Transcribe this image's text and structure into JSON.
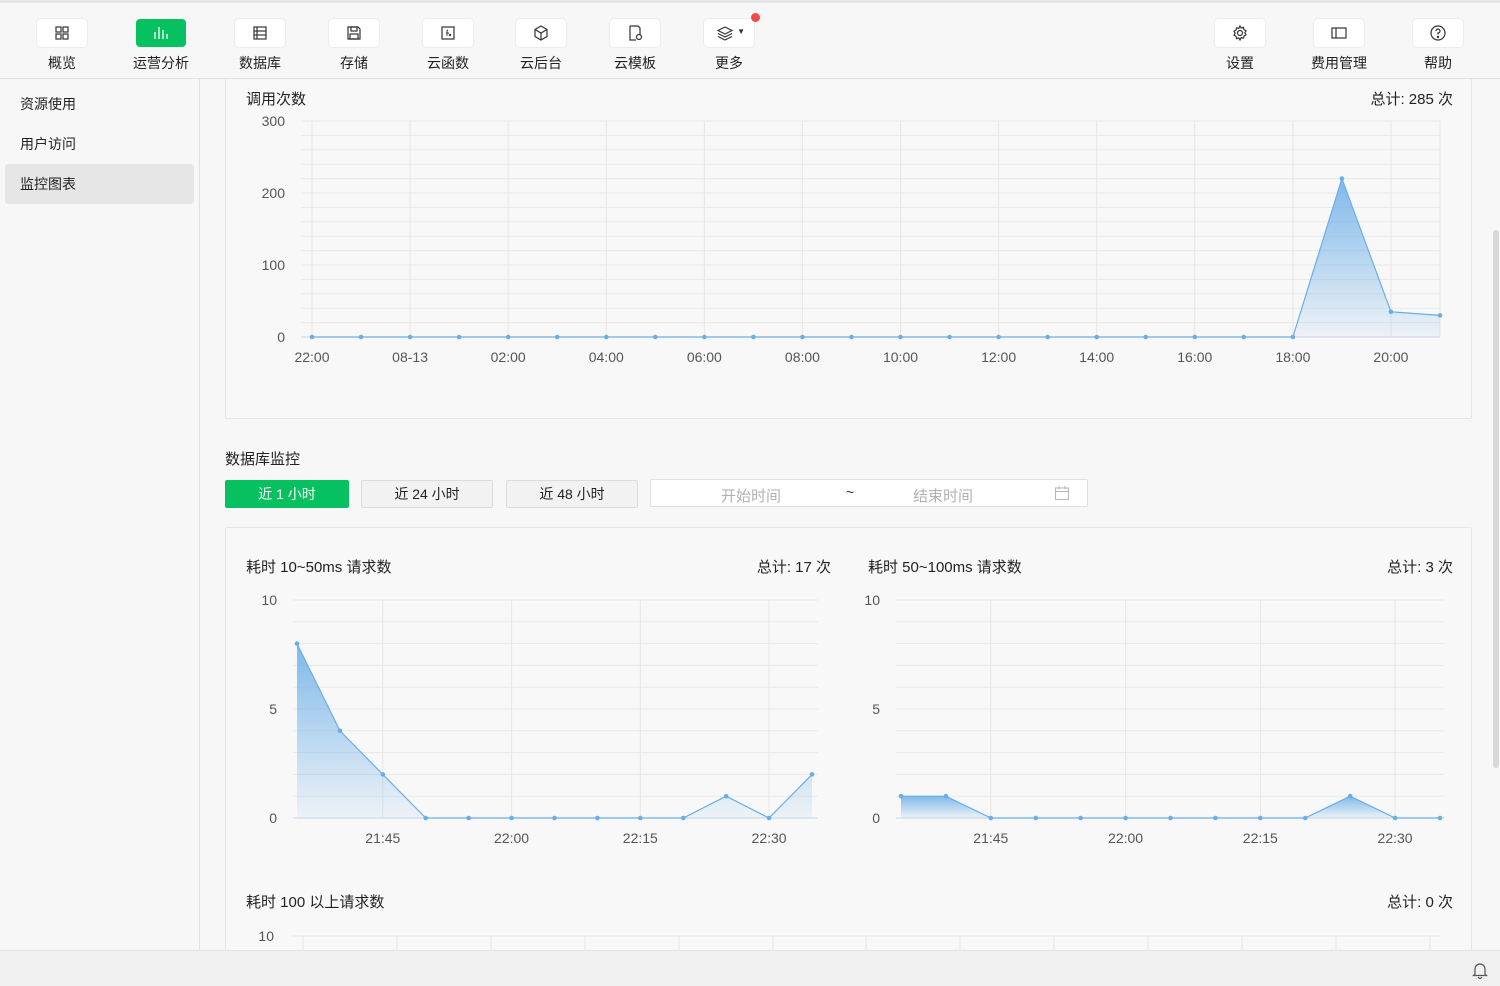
{
  "toolbar": {
    "items": [
      {
        "label": "概览",
        "icon": "grid-icon",
        "active": false
      },
      {
        "label": "运营分析",
        "icon": "bar-chart-icon",
        "active": true
      },
      {
        "label": "数据库",
        "icon": "database-icon",
        "active": false
      },
      {
        "label": "存储",
        "icon": "save-icon",
        "active": false
      },
      {
        "label": "云函数",
        "icon": "function-icon",
        "active": false
      },
      {
        "label": "云后台",
        "icon": "cube-icon",
        "active": false
      },
      {
        "label": "云模板",
        "icon": "template-icon",
        "active": false
      },
      {
        "label": "更多",
        "icon": "layers-icon",
        "active": false,
        "badge": true
      }
    ],
    "right_items": [
      {
        "label": "设置",
        "icon": "gear-icon"
      },
      {
        "label": "费用管理",
        "icon": "wallet-icon"
      },
      {
        "label": "帮助",
        "icon": "help-icon"
      }
    ]
  },
  "sidebar": {
    "items": [
      {
        "label": "资源使用",
        "active": false
      },
      {
        "label": "用户访问",
        "active": false
      },
      {
        "label": "监控图表",
        "active": true
      }
    ]
  },
  "calls_card": {
    "title": "调用次数",
    "total": "总计: 285 次"
  },
  "db_section": {
    "title": "数据库监控",
    "ranges": [
      "近 1 小时",
      "近 24 小时",
      "近 48 小时"
    ],
    "start_placeholder": "开始时间",
    "end_placeholder": "结束时间",
    "separator": "~"
  },
  "db_cards": {
    "c1": {
      "title": "耗时 10~50ms 请求数",
      "total": "总计: 17 次"
    },
    "c2": {
      "title": "耗时 50~100ms 请求数",
      "total": "总计: 3 次"
    },
    "c3": {
      "title": "耗时 100 以上请求数",
      "total": "总计: 0 次"
    }
  },
  "colors": {
    "accent": "#07c160",
    "series": "#6aaee8",
    "badge": "#f24a4a"
  },
  "chart_data": [
    {
      "type": "area",
      "title": "调用次数",
      "x_ticks": [
        "22:00",
        "08-13",
        "02:00",
        "04:00",
        "06:00",
        "08:00",
        "10:00",
        "12:00",
        "14:00",
        "16:00",
        "18:00",
        "20:00"
      ],
      "y_ticks": [
        0,
        100,
        200,
        300
      ],
      "ylim": [
        0,
        300
      ],
      "x": [
        "22:00",
        "23:00",
        "00:00",
        "01:00",
        "02:00",
        "03:00",
        "04:00",
        "05:00",
        "06:00",
        "07:00",
        "08:00",
        "09:00",
        "10:00",
        "11:00",
        "12:00",
        "13:00",
        "14:00",
        "15:00",
        "16:00",
        "17:00",
        "18:00",
        "19:00",
        "20:00",
        "21:00"
      ],
      "values": [
        0,
        0,
        0,
        0,
        0,
        0,
        0,
        0,
        0,
        0,
        0,
        0,
        0,
        0,
        0,
        0,
        0,
        0,
        0,
        0,
        0,
        220,
        35,
        30
      ],
      "grid": true
    },
    {
      "type": "area",
      "title": "耗时 10~50ms 请求数",
      "x_ticks": [
        "21:45",
        "22:00",
        "22:15",
        "22:30"
      ],
      "y_ticks": [
        0,
        5,
        10
      ],
      "ylim": [
        0,
        10
      ],
      "x": [
        "21:35",
        "21:40",
        "21:45",
        "21:50",
        "21:55",
        "22:00",
        "22:05",
        "22:10",
        "22:15",
        "22:20",
        "22:25",
        "22:30",
        "22:35"
      ],
      "values": [
        8,
        4,
        2,
        0,
        0,
        0,
        0,
        0,
        0,
        0,
        1,
        0,
        2
      ],
      "grid": true
    },
    {
      "type": "area",
      "title": "耗时 50~100ms 请求数",
      "x_ticks": [
        "21:45",
        "22:00",
        "22:15",
        "22:30"
      ],
      "y_ticks": [
        0,
        5,
        10
      ],
      "ylim": [
        0,
        10
      ],
      "x": [
        "21:35",
        "21:40",
        "21:45",
        "21:50",
        "21:55",
        "22:00",
        "22:05",
        "22:10",
        "22:15",
        "22:20",
        "22:25",
        "22:30",
        "22:35"
      ],
      "values": [
        1,
        1,
        0,
        0,
        0,
        0,
        0,
        0,
        0,
        0,
        1,
        0,
        0
      ],
      "grid": true
    },
    {
      "type": "area",
      "title": "耗时 100 以上请求数",
      "y_ticks": [
        10
      ],
      "ylim": [
        0,
        10
      ],
      "values": [],
      "grid": true
    }
  ]
}
